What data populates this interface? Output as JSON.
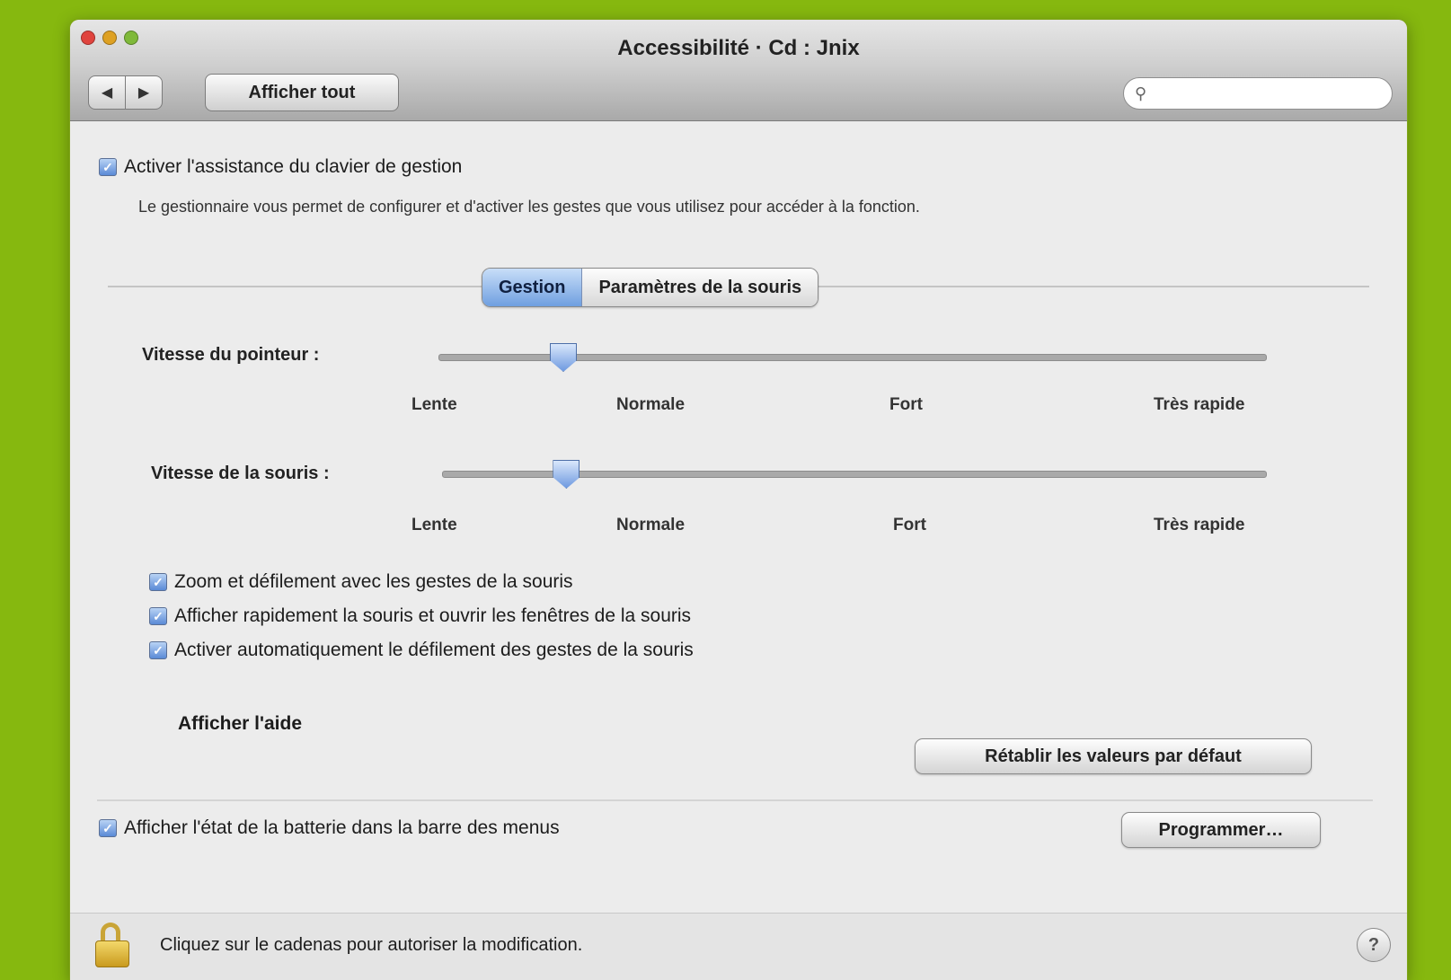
{
  "window": {
    "title": "Accessibilité · Cd : Jnix",
    "show_all_label": "Afficher tout",
    "back_icon": "chevron-left-icon",
    "forward_icon": "chevron-right-icon",
    "search_placeholder": ""
  },
  "main": {
    "enable_checkbox_label": "Activer l'assistance du clavier de gestion",
    "enable_checkbox_checked": true,
    "description": "Le gestionnaire vous permet de configurer et d'activer les gestes que vous utilisez pour accéder à la fonction.",
    "tabs": [
      "Gestion",
      "Paramètres de la souris"
    ],
    "active_tab": 0
  },
  "sliders": [
    {
      "label": "Vitesse du pointeur :",
      "value_fraction": 0.15,
      "ticks": [
        "Lente",
        "Normale",
        "Fort",
        "Très rapide"
      ]
    },
    {
      "label": "Vitesse de la souris :",
      "value_fraction": 0.15,
      "ticks": [
        "Lente",
        "Normale",
        "Fort",
        "Très rapide"
      ]
    }
  ],
  "options": [
    {
      "label": "Zoom et défilement avec les gestes de la souris",
      "checked": true
    },
    {
      "label": "Afficher rapidement la souris et ouvrir les fenêtres de la souris",
      "checked": true
    },
    {
      "label": "Activer automatiquement le défilement des gestes de la souris",
      "checked": true
    }
  ],
  "extra": {
    "link_label": "Afficher l'aide",
    "reset_button": "Rétablir les valeurs par défaut"
  },
  "bottom_option": {
    "label": "Afficher l'état de la batterie dans la barre des menus",
    "checked": true,
    "button": "Programmer…"
  },
  "footer": {
    "lock_text": "Cliquez sur le cadenas pour autoriser la modification.",
    "help_symbol": "?"
  }
}
